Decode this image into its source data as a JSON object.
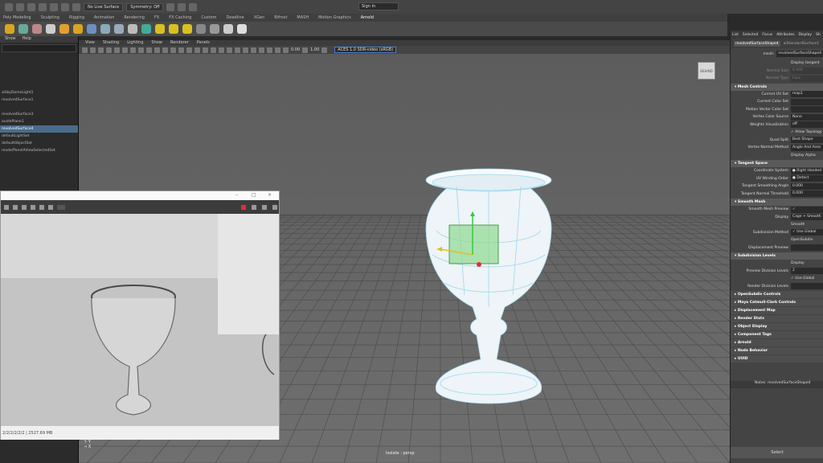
{
  "statusline": {
    "live_surface": "No Live Surface",
    "symmetry": "Symmetry: Off",
    "sign_in": "Sign In"
  },
  "shelf_tabs": [
    "Poly Modeling",
    "Sculpting",
    "Rigging",
    "Animation",
    "Rendering",
    "FX",
    "FX Caching",
    "Custom",
    "Deadline",
    "XGen",
    "Bifrost",
    "MASH",
    "Motion Graphics",
    "Arnold"
  ],
  "viewport_menu": [
    "View",
    "Shading",
    "Lighting",
    "Show",
    "Renderer",
    "Panels"
  ],
  "viewport_toolbar": {
    "field1": "0.00",
    "field2": "1.00",
    "color_space": "ACES 1.0 SDR-video (sRGB)"
  },
  "outliner": {
    "menu": [
      "Show",
      "Help"
    ],
    "items": [
      {
        "label": "aiSkyDomeLight1",
        "selected": false
      },
      {
        "label": "revolvedSurface1",
        "selected": false
      },
      {
        "label": "",
        "selected": false
      },
      {
        "label": "revolvedSurface3",
        "selected": false
      },
      {
        "label": "ouidePlane1",
        "selected": false
      },
      {
        "label": "revolvedSurface4",
        "selected": true
      },
      {
        "label": "defaultLightSet",
        "selected": false
      },
      {
        "label": "defaultObjectSet",
        "selected": false
      },
      {
        "label": "mode/PanelAViewSelectedSet",
        "selected": false
      }
    ]
  },
  "viewport": {
    "viewcube_label": "BEHIND",
    "isolate_label": "Isolate : persp"
  },
  "render_window": {
    "status": "2/2/2/2/2/2 | 2527.69 MB"
  },
  "attribute_editor": {
    "tabs": [
      "List",
      "Selected",
      "Focus",
      "Attributes",
      "Display",
      "Sh"
    ],
    "node_tabs": [
      "revolvedSurfaceShape4",
      "aiStandardSurface1"
    ],
    "mesh_label": "mesh:",
    "mesh_value": "revolvedSurfaceShape4",
    "top_rows": [
      {
        "label": "",
        "value": "Display tangent"
      },
      {
        "label": "Normal Size",
        "value": "0.400"
      },
      {
        "label": "Normal Type",
        "value": "Face"
      }
    ],
    "sections": [
      {
        "title": "Mesh Controls",
        "open": true,
        "rows": [
          {
            "label": "Current UV Set",
            "value": "map1"
          },
          {
            "label": "Current Color Set",
            "value": ""
          },
          {
            "label": "Motion Vector Color Set",
            "value": ""
          },
          {
            "label": "Vertex Color Source",
            "value": "None"
          },
          {
            "label": "Weights Visualization",
            "value": "off"
          },
          {
            "label": "",
            "value": "✓ Allow Topology"
          },
          {
            "label": "Quad Split",
            "value": "Best Shape"
          },
          {
            "label": "Vertex Normal Method",
            "value": "Angle And Area"
          },
          {
            "label": "",
            "value": "Display Alpha"
          }
        ]
      },
      {
        "title": "Tangent Space",
        "open": true,
        "rows": [
          {
            "label": "Coordinate System",
            "value": "● Right Handed"
          },
          {
            "label": "UV Winding Order",
            "value": "● Detect"
          },
          {
            "label": "Tangent Smoothing Angle",
            "value": "0.000"
          },
          {
            "label": "Tangent Normal Threshold",
            "value": "0.000"
          }
        ]
      },
      {
        "title": "Smooth Mesh",
        "open": true,
        "rows": [
          {
            "label": "Smooth Mesh Preview",
            "value": "✓"
          },
          {
            "label": "Display",
            "value": "Cage + Smooth"
          },
          {
            "label": "",
            "value": "Smooth"
          },
          {
            "label": "Subdivision Method",
            "value": "✓ Use Global"
          },
          {
            "label": "",
            "value": "OpenSubdiv"
          },
          {
            "label": "Displacement Preview",
            "value": ""
          }
        ]
      },
      {
        "title": "Subdivision Levels",
        "open": true,
        "rows": [
          {
            "label": "",
            "value": "Display"
          },
          {
            "label": "Preview Division Levels",
            "value": "2"
          },
          {
            "label": "",
            "value": "✓ Use Global"
          },
          {
            "label": "Render Division Levels",
            "value": ""
          }
        ]
      },
      {
        "title": "OpenSubdiv Controls",
        "open": false,
        "rows": []
      },
      {
        "title": "Maya Catmull-Clark Controls",
        "open": false,
        "rows": []
      },
      {
        "title": "Displacement Map",
        "open": false,
        "rows": []
      },
      {
        "title": "Render Stats",
        "open": false,
        "rows": []
      },
      {
        "title": "Object Display",
        "open": false,
        "rows": []
      },
      {
        "title": "Component Tags",
        "open": false,
        "rows": []
      },
      {
        "title": "Arnold",
        "open": false,
        "rows": []
      },
      {
        "title": "Node Behavior",
        "open": false,
        "rows": []
      },
      {
        "title": "UUID",
        "open": false,
        "rows": []
      }
    ],
    "notes": "Notes: revolvedSurfaceShape4",
    "select_button": "Select"
  }
}
